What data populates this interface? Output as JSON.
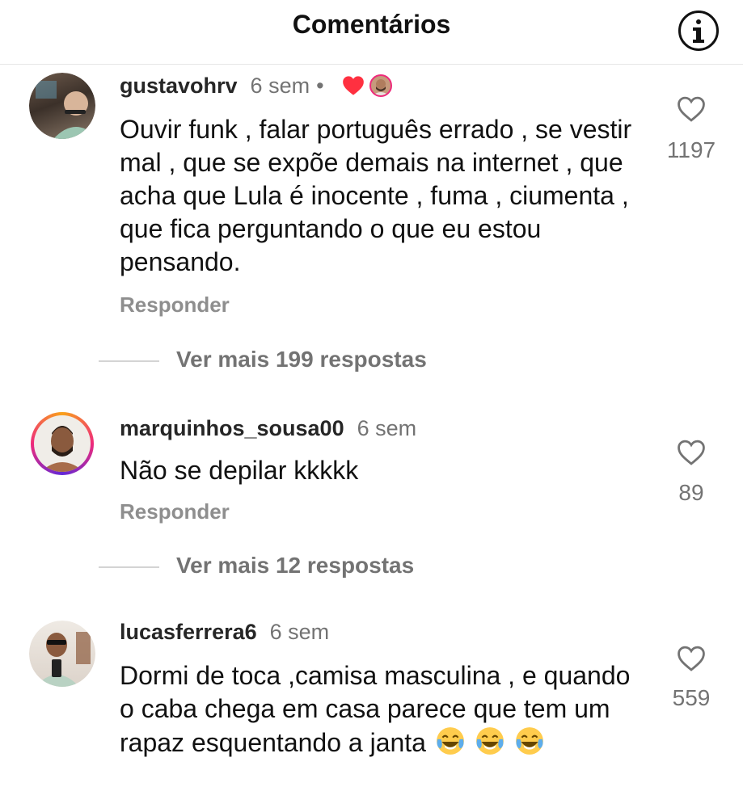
{
  "header": {
    "title": "Comentários",
    "info_icon": "info-circle-icon"
  },
  "comments": [
    {
      "username": "gustavohrv",
      "time": "6 sem",
      "separator": "•",
      "creator_liked": true,
      "text": "Ouvir funk , falar português errado , se vestir mal , que se expõe demais na internet , que acha que Lula é inocente , fuma , ciumenta , que fica perguntando o que eu estou pensando.",
      "reply_label": "Responder",
      "like_count": "1197",
      "more_replies": "Ver mais 199 respostas"
    },
    {
      "username": "marquinhos_sousa00",
      "time": "6 sem",
      "text": "Não se depilar kkkkk",
      "reply_label": "Responder",
      "like_count": "89",
      "more_replies": "Ver mais 12 respostas"
    },
    {
      "username": "lucasferrera6",
      "time": "6 sem",
      "text": "Dormi de toca ,camisa masculina , e quando o caba chega em casa parece que tem um rapaz esquentando a janta",
      "emoji": "face-with-tears-of-joy-icon",
      "like_count": "559"
    }
  ],
  "colors": {
    "heart_red": "#ff3040",
    "secondary_text": "#737373",
    "story_ring": "#ee2a7b"
  }
}
